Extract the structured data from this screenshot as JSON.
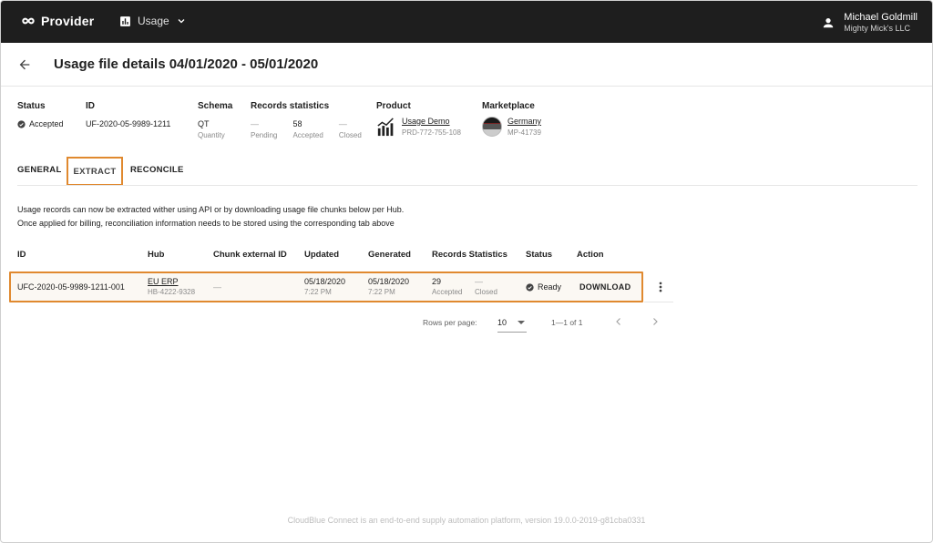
{
  "topbar": {
    "brand": "Provider",
    "nav_label": "Usage",
    "user_name": "Michael Goldmill",
    "user_org": "Mighty Mick's LLC"
  },
  "header": {
    "title": "Usage file details 04/01/2020 - 05/01/2020"
  },
  "summary": {
    "status_label": "Status",
    "status_value": "Accepted",
    "id_label": "ID",
    "id_value": "UF-2020-05-9989-1211",
    "schema_label": "Schema",
    "schema_value": "QT",
    "schema_sub": "Quantity",
    "records_label": "Records statistics",
    "records": [
      {
        "value": "—",
        "label": "Pending"
      },
      {
        "value": "58",
        "label": "Accepted"
      },
      {
        "value": "—",
        "label": "Closed"
      }
    ],
    "product_label": "Product",
    "product_name": "Usage Demo",
    "product_id": "PRD-772-755-108",
    "marketplace_label": "Marketplace",
    "marketplace_name": "Germany",
    "marketplace_id": "MP-41739"
  },
  "tabs": [
    {
      "label": "GENERAL"
    },
    {
      "label": "EXTRACT"
    },
    {
      "label": "RECONCILE"
    }
  ],
  "description": {
    "line1": "Usage records can now be extracted wither using API or by downloading usage file chunks below per Hub.",
    "line2": "Once applied for billing, reconciliation information needs to be stored using the corresponding tab above"
  },
  "table": {
    "columns": [
      "ID",
      "Hub",
      "Chunk external ID",
      "Updated",
      "Generated",
      "Records Statistics",
      "Status",
      "Action"
    ],
    "rows": [
      {
        "id": "UFC-2020-05-9989-1211-001",
        "hub_name": "EU ERP",
        "hub_id": "HB-4222-9328",
        "chunk_external_id": "—",
        "updated_date": "05/18/2020",
        "updated_time": "7:22 PM",
        "generated_date": "05/18/2020",
        "generated_time": "7:22 PM",
        "accepted_value": "29",
        "accepted_label": "Accepted",
        "closed_value": "—",
        "closed_label": "Closed",
        "status": "Ready",
        "action": "DOWNLOAD"
      }
    ]
  },
  "pagination": {
    "rows_per_page_label": "Rows per page:",
    "rows_per_page": "10",
    "range": "1—1 of 1"
  },
  "footer": {
    "text": "CloudBlue Connect is an end-to-end supply automation platform, version 19.0.0-2019-g81cba0331"
  },
  "colors": {
    "topbar": "#1e1e1e",
    "highlight": "#e0892f"
  }
}
